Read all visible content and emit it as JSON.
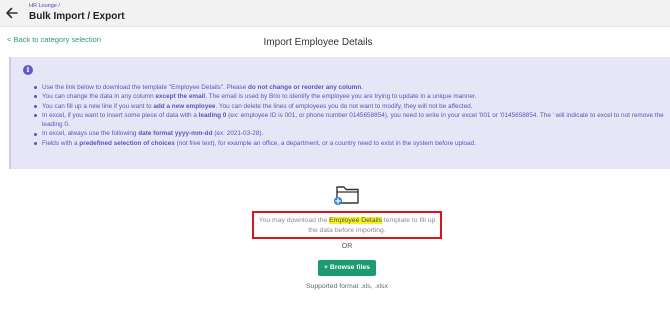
{
  "header": {
    "breadcrumb": "HR Lounge /",
    "title": "Bulk Import / Export"
  },
  "back_link": "< Back to category selection",
  "section_title": "Import Employee Details",
  "info": {
    "items": [
      [
        {
          "t": "Use the link below to download the template \"Employee Details\". Please ",
          "b": false
        },
        {
          "t": "do not change or reorder any column",
          "b": true
        },
        {
          "t": ".",
          "b": false
        }
      ],
      [
        {
          "t": "You can change the data in any column ",
          "b": false
        },
        {
          "t": "except the email",
          "b": true
        },
        {
          "t": ". The email is used by Brio to identify the employee you are trying to update in a unique manner.",
          "b": false
        }
      ],
      [
        {
          "t": "You can fill up a new line if you want to ",
          "b": false
        },
        {
          "t": "add a new employee",
          "b": true
        },
        {
          "t": ". You can delete the lines of employees you do not want to modify, they will not be affected.",
          "b": false
        }
      ],
      [
        {
          "t": "In excel, if you want to insert some piece of data with a ",
          "b": false
        },
        {
          "t": "leading 0",
          "b": true
        },
        {
          "t": " (ex: employee ID is 001, or phone number 0145658854), you need to write in your excel '001 or '0145658854. The ' will indicate to excel to not remove the leading 0.",
          "b": false
        }
      ],
      [
        {
          "t": "In excel, always use the following ",
          "b": false
        },
        {
          "t": "date format yyyy-mm-dd",
          "b": true
        },
        {
          "t": " (ex: 2021-03-28).",
          "b": false
        }
      ],
      [
        {
          "t": "Fields with a ",
          "b": false
        },
        {
          "t": "predefined selection of choices",
          "b": true
        },
        {
          "t": " (not free text), for example an office, a department, or a country need to exist in the system before upload.",
          "b": false
        }
      ]
    ]
  },
  "download": {
    "prefix": "You may download the ",
    "link": "Employee Details",
    "suffix": " template to fill up the data before importing."
  },
  "or_text": "OR",
  "browse_button": "+ Browse files",
  "supported_format": "Supported format .xls, .xlsx",
  "icons": {
    "back": "arrow-left-icon",
    "info": "info-circle-icon",
    "folder": "folder-upload-icon"
  },
  "colors": {
    "accent": "#1c9b73",
    "info_text": "#5d53c0",
    "info_bg": "#e6e6f6",
    "highlight": "#f4f21e",
    "box_border": "#d8151b"
  }
}
